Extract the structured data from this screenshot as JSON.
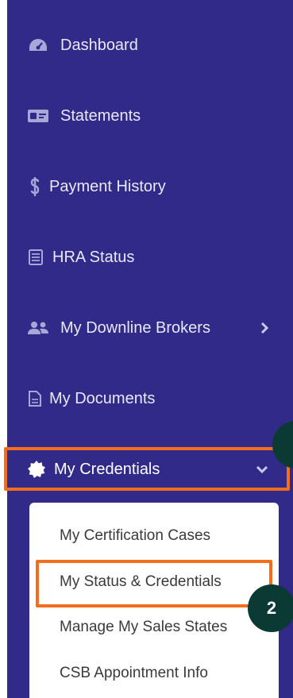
{
  "nav": {
    "dashboard": {
      "label": "Dashboard",
      "icon": "tachometer-icon"
    },
    "statements": {
      "label": "Statements",
      "icon": "money-bill-icon"
    },
    "payment_history": {
      "label": "Payment History",
      "icon": "dollar-icon"
    },
    "hra_status": {
      "label": "HRA Status",
      "icon": "document-list-icon"
    },
    "downline_brokers": {
      "label": "My Downline Brokers",
      "icon": "users-icon"
    },
    "documents": {
      "label": "My Documents",
      "icon": "file-icon"
    },
    "credentials": {
      "label": "My Credentials",
      "icon": "badge-icon"
    }
  },
  "submenu": {
    "items": [
      {
        "label": "My Certification Cases"
      },
      {
        "label": "My Status & Credentials"
      },
      {
        "label": "Manage My Sales States"
      },
      {
        "label": "CSB Appointment Info"
      }
    ]
  },
  "annotations": {
    "step_badge": "2"
  },
  "colors": {
    "sidebar_bg": "#312a88",
    "highlight": "#f26e1d",
    "badge_bg": "#0b3a35"
  }
}
